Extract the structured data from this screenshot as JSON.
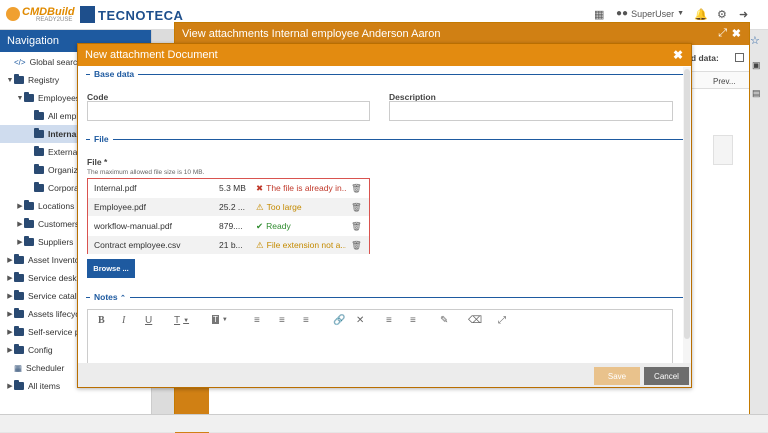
{
  "topbar": {
    "logo_text": "CMDBuild",
    "logo_sub": "READY2USE",
    "brand2": "TECNOTECA",
    "user": "SuperUser",
    "icons": {
      "calendar": "calendar-icon",
      "user": "user-group-icon",
      "bell": "bell-icon",
      "gear": "gear-icon",
      "logout": "logout-icon"
    }
  },
  "nav": {
    "title": "Navigation",
    "items": [
      {
        "label": "Global search",
        "level": 0,
        "icon": "code"
      },
      {
        "label": "Registry",
        "level": 0,
        "caret": "down"
      },
      {
        "label": "Employees",
        "level": 1,
        "caret": "down"
      },
      {
        "label": "All empl",
        "level": 2
      },
      {
        "label": "Internal",
        "level": 2,
        "selected": true
      },
      {
        "label": "External",
        "level": 2
      },
      {
        "label": "Organiz",
        "level": 2
      },
      {
        "label": "Corpora",
        "level": 2
      },
      {
        "label": "Locations",
        "level": 1,
        "caret": "right"
      },
      {
        "label": "Customers",
        "level": 1,
        "caret": "right"
      },
      {
        "label": "Suppliers",
        "level": 1,
        "caret": "right"
      },
      {
        "label": "Asset Invento",
        "level": 0,
        "caret": "right"
      },
      {
        "label": "Service desk",
        "level": 0,
        "caret": "right"
      },
      {
        "label": "Service catalo",
        "level": 0,
        "caret": "right"
      },
      {
        "label": "Assets lifecycl",
        "level": 0,
        "caret": "right"
      },
      {
        "label": "Self-service p",
        "level": 0,
        "caret": "right"
      },
      {
        "label": "Config",
        "level": 0,
        "caret": "right"
      },
      {
        "label": "Scheduler",
        "level": 0,
        "icon": "calendar"
      },
      {
        "label": "All items",
        "level": 0,
        "caret": "right"
      }
    ]
  },
  "view": {
    "title": "View attachments Internal employee Anderson Aaron",
    "filter_label": "ded data:",
    "col_prev": "Prev..."
  },
  "modal": {
    "title": "New attachment Document",
    "base_data": "Base data",
    "code_label": "Code",
    "description_label": "Description",
    "file_section": "File",
    "file_label": "File *",
    "hint": "The maximum allowed file size is 10 MB.",
    "files": [
      {
        "name": "Internal.pdf",
        "size": "5.3 MB",
        "status": "The file is already in...",
        "kind": "err"
      },
      {
        "name": "Employee.pdf",
        "size": "25.2 ...",
        "status": "Too large",
        "kind": "warn"
      },
      {
        "name": "workflow-manual.pdf",
        "size": "879....",
        "status": "Ready",
        "kind": "ok"
      },
      {
        "name": "Contract employee.csv",
        "size": "21 b...",
        "status": "File extension not a...",
        "kind": "warn"
      }
    ],
    "browse": "Browse ...",
    "notes": "Notes",
    "save": "Save",
    "cancel": "Cancel"
  }
}
